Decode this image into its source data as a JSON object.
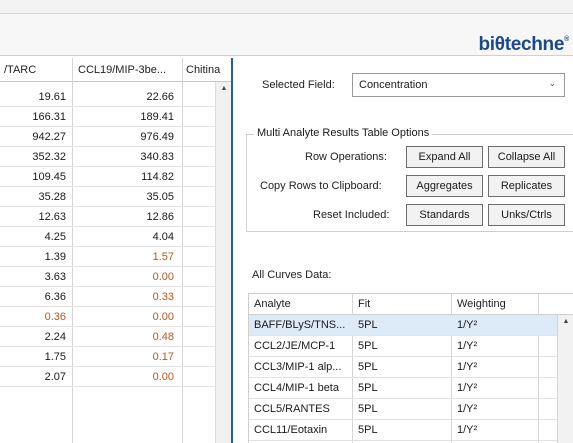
{
  "brand": {
    "logo_text": "bio-techne",
    "logo_main": "biθtechne",
    "logo_mark": "®"
  },
  "grid": {
    "columns": [
      "/TARC",
      "CCL19/MIP-3be...",
      "Chitina"
    ],
    "rows": [
      {
        "a": "19.61",
        "b": "22.66",
        "b_color": "#1a1a1a"
      },
      {
        "a": "166.31",
        "b": "189.41",
        "b_color": "#1a1a1a"
      },
      {
        "a": "942.27",
        "b": "976.49",
        "b_color": "#1a1a1a"
      },
      {
        "a": "352.32",
        "b": "340.83",
        "b_color": "#1a1a1a"
      },
      {
        "a": "109.45",
        "b": "114.82",
        "b_color": "#1a1a1a"
      },
      {
        "a": "35.28",
        "b": "35.05",
        "b_color": "#1a1a1a"
      },
      {
        "a": "12.63",
        "b": "12.86",
        "b_color": "#1a1a1a"
      },
      {
        "a": "4.25",
        "b": "4.04",
        "b_color": "#1a1a1a"
      },
      {
        "a": "1.39",
        "b": "1.57",
        "b_color": "#b65a1e"
      },
      {
        "a": "3.63",
        "b": "0.00",
        "b_color": "#b65a1e"
      },
      {
        "a": "6.36",
        "b": "0.33",
        "b_color": "#b65a1e"
      },
      {
        "a": "0.36",
        "b": "0.00",
        "a_color": "#b65a1e",
        "b_color": "#b65a1e"
      },
      {
        "a": "2.24",
        "b": "0.48",
        "b_color": "#b65a1e"
      },
      {
        "a": "1.75",
        "b": "0.17",
        "b_color": "#b65a1e"
      },
      {
        "a": "2.07",
        "b": "0.00",
        "b_color": "#b65a1e"
      }
    ]
  },
  "selected_field": {
    "label": "Selected Field:",
    "value": "Concentration"
  },
  "options": {
    "title": "Multi Analyte Results Table Options",
    "row_ops_label": "Row Operations:",
    "expand_all": "Expand All",
    "collapse_all": "Collapse All",
    "copy_label": "Copy Rows to Clipboard:",
    "aggregates": "Aggregates",
    "replicates": "Replicates",
    "reset_label": "Reset Included:",
    "standards": "Standards",
    "unks_ctrls": "Unks/Ctrls"
  },
  "curves": {
    "title": "All Curves Data:",
    "headers": [
      "Analyte",
      "Fit",
      "Weighting"
    ],
    "rows": [
      {
        "analyte": "BAFF/BLyS/TNS...",
        "fit": "5PL",
        "weighting": "1/Y²",
        "selected": true
      },
      {
        "analyte": "CCL2/JE/MCP-1",
        "fit": "5PL",
        "weighting": "1/Y²"
      },
      {
        "analyte": "CCL3/MIP-1 alp...",
        "fit": "5PL",
        "weighting": "1/Y²"
      },
      {
        "analyte": "CCL4/MIP-1 beta",
        "fit": "5PL",
        "weighting": "1/Y²"
      },
      {
        "analyte": "CCL5/RANTES",
        "fit": "5PL",
        "weighting": "1/Y²"
      },
      {
        "analyte": "CCL11/Eotaxin",
        "fit": "5PL",
        "weighting": "1/Y²"
      }
    ]
  },
  "colors": {
    "accent": "#1f5fa8",
    "logo": "#1b4a8c",
    "out_of_range": "#b65a1e",
    "selected_row": "#ddebf8"
  }
}
